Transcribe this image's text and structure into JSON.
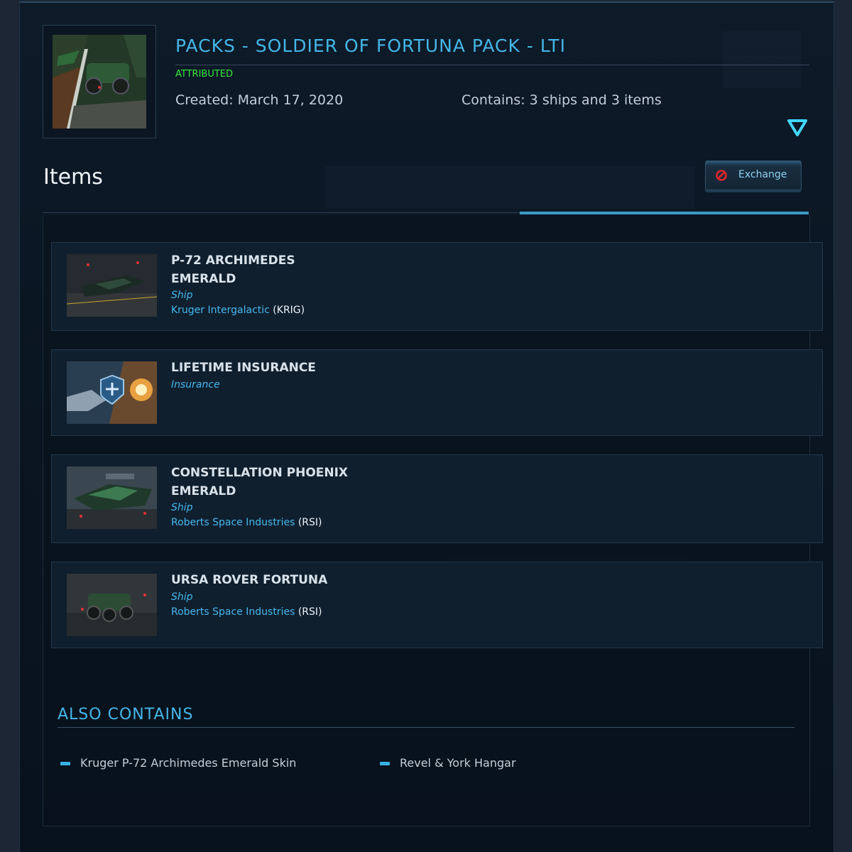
{
  "pack": {
    "title": "PACKS - SOLDIER OF FORTUNA PACK - LTI",
    "status": "ATTRIBUTED",
    "created": "Created: March 17, 2020",
    "contains": "Contains: 3 ships and 3 items",
    "thumbnail_icon": "pack-artwork"
  },
  "items_section": {
    "heading": "Items",
    "exchange_label": "Exchange",
    "exchange_icon": "prohibited-icon"
  },
  "items": [
    {
      "title": "P-72 ARCHIMEDES EMERALD",
      "type": "Ship",
      "manufacturer": "Kruger Intergalactic",
      "code": "(KRIG)"
    },
    {
      "title": "LIFETIME INSURANCE",
      "type": "Insurance"
    },
    {
      "title": "CONSTELLATION PHOENIX EMERALD",
      "type": "Ship",
      "manufacturer": "Roberts Space Industries",
      "code": "(RSI)"
    },
    {
      "title": "URSA ROVER FORTUNA",
      "type": "Ship",
      "manufacturer": "Roberts Space Industries",
      "code": "(RSI)"
    }
  ],
  "also_contains": {
    "heading": "ALSO CONTAINS",
    "entries": [
      "Kruger P-72 Archimedes Emerald Skin",
      "Revel & York Hangar"
    ]
  },
  "colors": {
    "accent_blue": "#45b6e8",
    "status_green": "#37e83e",
    "background": "#0a1521"
  }
}
